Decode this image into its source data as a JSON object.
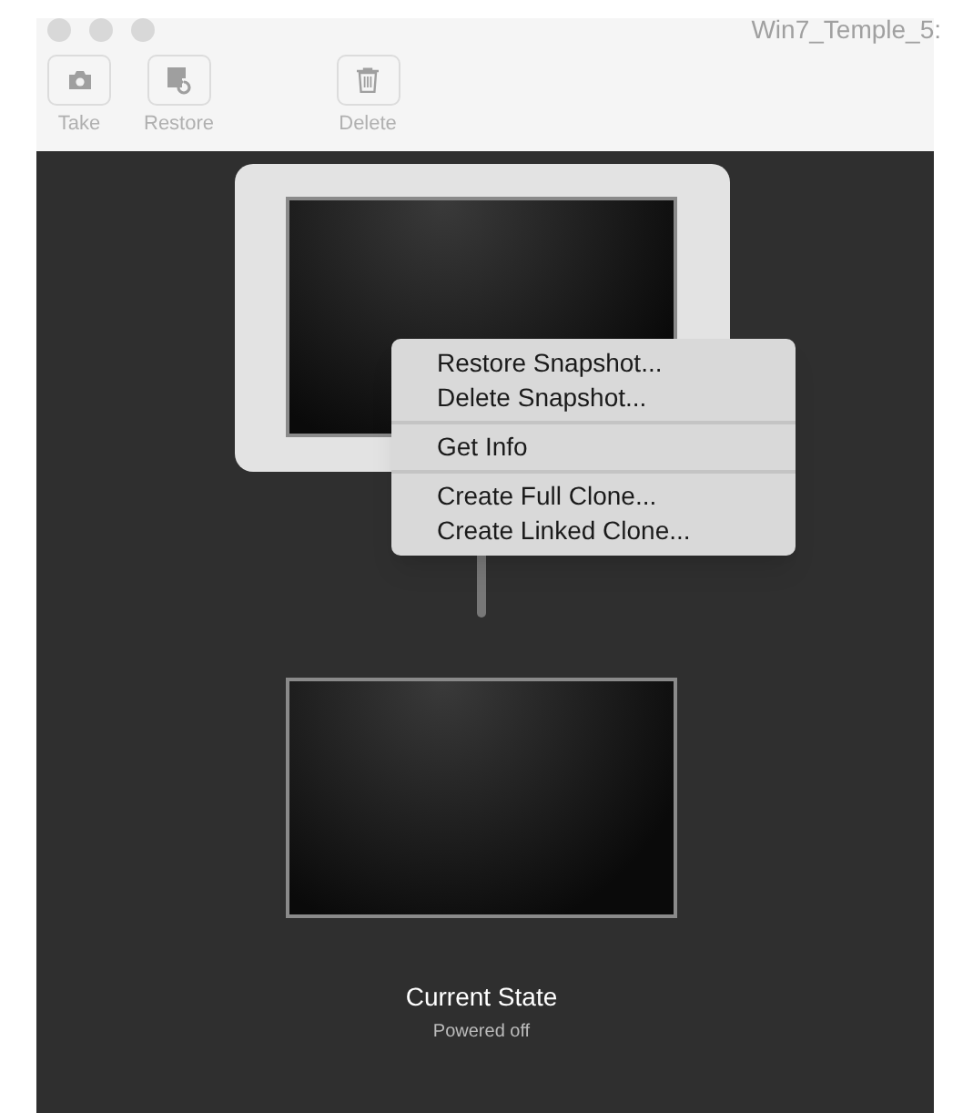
{
  "window": {
    "title": "Win7_Temple_5:"
  },
  "toolbar": [
    {
      "kind": "camera",
      "label": "Take",
      "disabled": true
    },
    {
      "kind": "restore",
      "label": "Restore",
      "disabled": true
    },
    {
      "kind": "trash",
      "label": "Delete",
      "disabled": true
    }
  ],
  "snapshots": [
    {
      "selected": true
    }
  ],
  "context_menu": {
    "groups": [
      [
        "Restore Snapshot...",
        "Delete Snapshot..."
      ],
      [
        "Get Info"
      ],
      [
        "Create Full Clone...",
        "Create Linked Clone..."
      ]
    ]
  },
  "current_state": {
    "title": "Current State",
    "status": "Powered off"
  }
}
